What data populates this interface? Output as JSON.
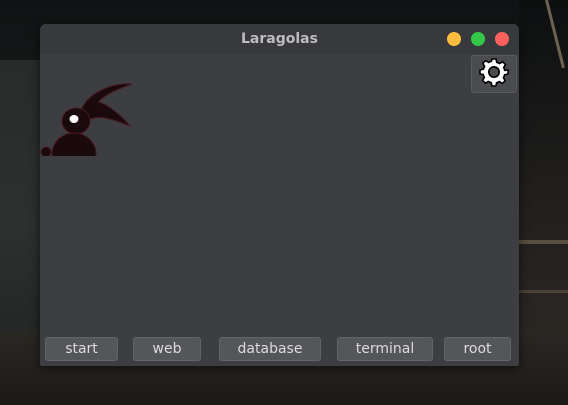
{
  "window": {
    "title": "Laragolas",
    "controls": {
      "minimize_color": "#fdbc40",
      "maximize_color": "#33c748",
      "close_color": "#fc605c"
    }
  },
  "toolbar": {
    "settings_icon": "gear-icon"
  },
  "logo": {
    "icon": "rabbit-logo"
  },
  "buttons": [
    {
      "label": "start"
    },
    {
      "label": "web"
    },
    {
      "label": "database"
    },
    {
      "label": "terminal"
    },
    {
      "label": "root"
    }
  ]
}
